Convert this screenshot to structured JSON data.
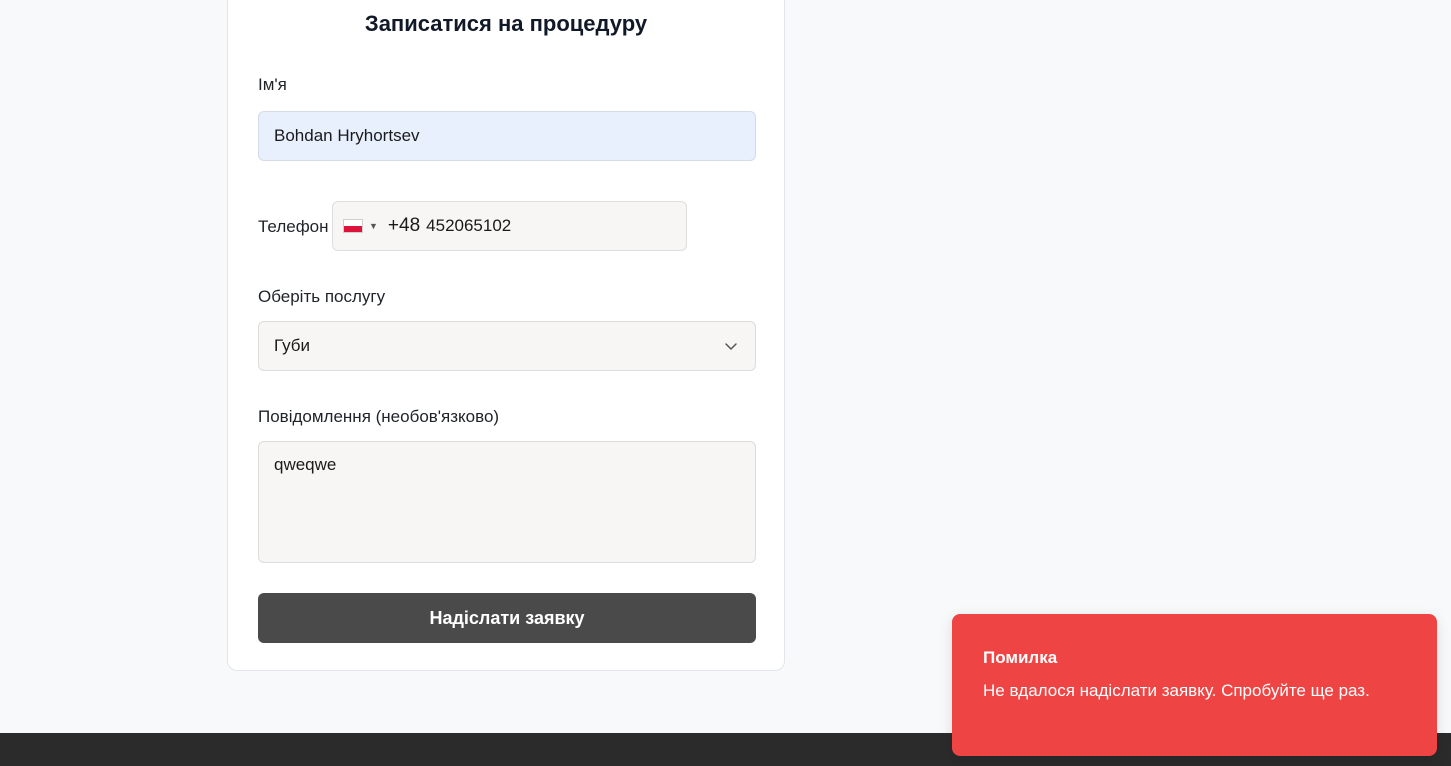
{
  "form": {
    "title": "Записатися на процедуру",
    "name_label": "Ім'я",
    "name_value": "Bohdan Hryhortsev",
    "phone_label": "Телефон",
    "phone_country_flag": "poland-flag-icon",
    "phone_dial_code": "+48",
    "phone_number": "452065102",
    "service_label": "Оберіть послугу",
    "service_selected": "Губи",
    "message_label": "Повідомлення (необов'язково)",
    "message_value": "qweqwe",
    "submit_label": "Надіслати заявку"
  },
  "toast": {
    "title": "Помилка",
    "description": "Не вдалося надіслати заявку. Спробуйте ще раз.",
    "color": "#ef4444"
  },
  "colors": {
    "submit_bg": "#4a4a4a",
    "footer_bg": "#2b2b2b"
  }
}
